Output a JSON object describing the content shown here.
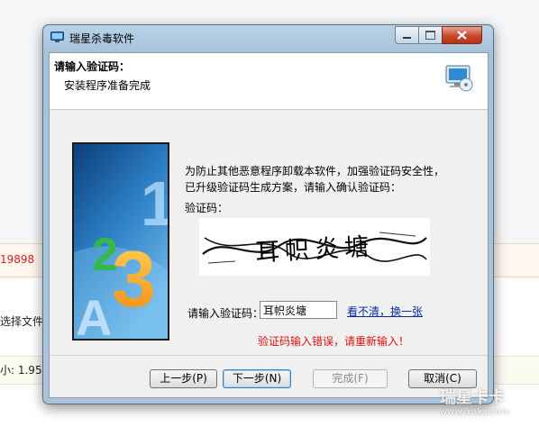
{
  "background": {
    "number_text": "19898",
    "select_text": "选择文件",
    "size_text": "小: 1.95"
  },
  "window": {
    "title": "瑞星杀毒软件",
    "icons": {
      "app": "monitor-icon",
      "minimize": "minimize-icon",
      "maximize": "maximize-icon",
      "close": "close-icon"
    }
  },
  "header": {
    "heading": "请输入验证码：",
    "subheading": "安装程序准备完成",
    "icon": "computer-disc-icon"
  },
  "main": {
    "instruction_line1": "为防止其他恶意程序卸载本软件，加强验证码安全性，",
    "instruction_line2": "已升级验证码生成方案，请输入确认验证码：",
    "code_label": "验证码：",
    "captcha_text": "耳帜炎塘",
    "input_label": "请输入验证码：",
    "input_value": "耳帜炎塘",
    "refresh_link": "看不清，换一张",
    "error_message": "验证码输入错误，请重新输入！",
    "side_image_glyphs": [
      "A",
      "2",
      "3",
      "1"
    ]
  },
  "buttons": {
    "back": "上一步(P)",
    "next": "下一步(N)",
    "finish": "完成(F)",
    "cancel": "取消(C)"
  },
  "watermark": {
    "logo_text": "瑞星卡卡",
    "url": "www.ikaka.com"
  },
  "colors": {
    "error": "#e01010",
    "link": "#0a2a9a",
    "title_bar": "#a7c3dc"
  }
}
